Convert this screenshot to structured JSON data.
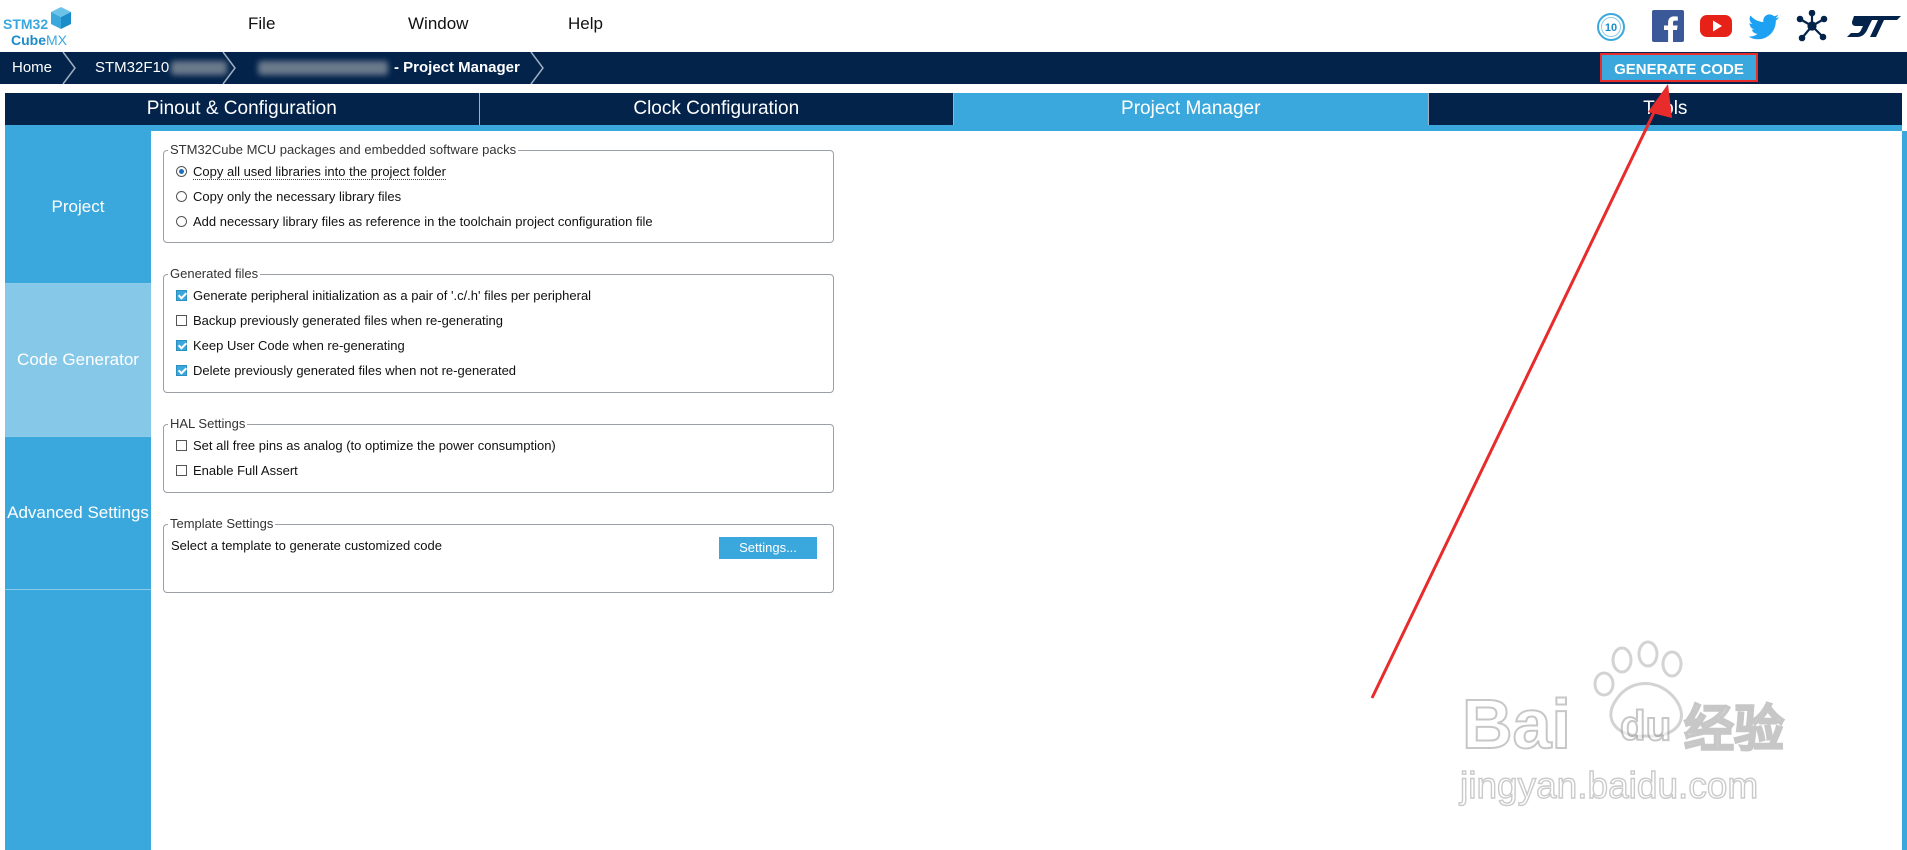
{
  "app": {
    "logo_line1": "STM32",
    "logo_line2": "Cube",
    "logo_line2_suffix": "MX",
    "anniversary_badge": "10"
  },
  "menu": [
    "File",
    "Window",
    "Help"
  ],
  "social_icons": [
    "facebook-icon",
    "youtube-icon",
    "twitter-icon",
    "network-icon",
    "st-logo"
  ],
  "breadcrumb": {
    "home": "Home",
    "device": "STM32F10",
    "page_suffix": "- Project Manager"
  },
  "generate_button": "GENERATE CODE",
  "tabs": [
    {
      "label": "Pinout & Configuration",
      "active": false
    },
    {
      "label": "Clock Configuration",
      "active": false
    },
    {
      "label": "Project Manager",
      "active": true
    },
    {
      "label": "Tools",
      "active": false
    }
  ],
  "sidebar": [
    {
      "label": "Project",
      "active": false
    },
    {
      "label": "Code Generator",
      "active": true
    },
    {
      "label": "Advanced Settings",
      "active": false
    }
  ],
  "groups": {
    "packages": {
      "legend": "STM32Cube MCU packages and embedded software packs",
      "options": [
        {
          "label": "Copy all used libraries into the project folder",
          "selected": true
        },
        {
          "label": "Copy only the necessary library files",
          "selected": false
        },
        {
          "label": "Add necessary library files as reference in the toolchain project configuration file",
          "selected": false
        }
      ]
    },
    "generated": {
      "legend": "Generated files",
      "options": [
        {
          "label": "Generate peripheral initialization as a pair of '.c/.h' files per peripheral",
          "checked": true
        },
        {
          "label": "Backup previously generated files when re-generating",
          "checked": false
        },
        {
          "label": "Keep User Code when re-generating",
          "checked": true
        },
        {
          "label": "Delete previously generated files when not re-generated",
          "checked": true
        }
      ]
    },
    "hal": {
      "legend": "HAL Settings",
      "options": [
        {
          "label": "Set all free pins as analog (to optimize the power consumption)",
          "checked": false
        },
        {
          "label": "Enable Full Assert",
          "checked": false
        }
      ]
    },
    "template": {
      "legend": "Template Settings",
      "text": "Select a template to generate customized code",
      "button": "Settings..."
    }
  },
  "watermark": {
    "brand": "Bai",
    "brand2": "du",
    "cn": "经验",
    "url": "jingyan.baidu.com"
  },
  "colors": {
    "navy": "#03234b",
    "accent": "#3aa8dc",
    "annotation": "#e82c2c"
  }
}
